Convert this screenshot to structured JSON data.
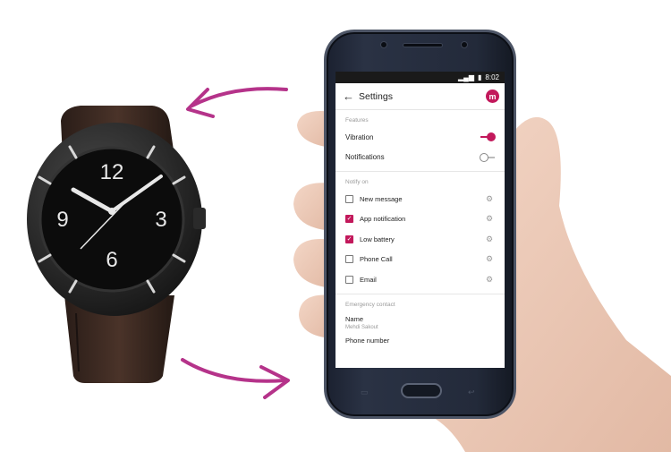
{
  "status_bar": {
    "time": "8:02",
    "signal_icon": "signal-icon",
    "battery_icon": "battery-icon"
  },
  "app_bar": {
    "back_icon": "arrow-left-icon",
    "title": "Settings",
    "avatar_letter": "m"
  },
  "features": {
    "section_label": "Features",
    "items": [
      {
        "label": "Vibration",
        "enabled": true
      },
      {
        "label": "Notifications",
        "enabled": false
      }
    ]
  },
  "notify_on": {
    "section_label": "Notify on",
    "items": [
      {
        "label": "New message",
        "checked": false
      },
      {
        "label": "App notification",
        "checked": true
      },
      {
        "label": "Low battery",
        "checked": true
      },
      {
        "label": "Phone Call",
        "checked": false
      },
      {
        "label": "Email",
        "checked": false
      }
    ]
  },
  "emergency_contact": {
    "section_label": "Emergency contact",
    "name_label": "Name",
    "name_value": "Mehdi Sakout",
    "phone_label": "Phone number"
  },
  "watch_dial": {
    "numerals": [
      "12",
      "3",
      "6",
      "9"
    ]
  },
  "colors": {
    "accent": "#c2185b",
    "arrow": "#b5338a",
    "phone_body": "#232a3a"
  }
}
